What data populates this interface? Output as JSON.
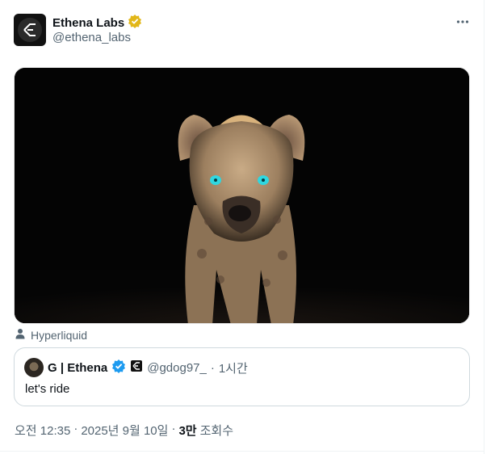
{
  "author": {
    "display_name": "Ethena Labs",
    "handle": "@ethena_labs",
    "avatar_icon": "ethena-logo-icon",
    "verified_badge": "gold-verified-badge-icon"
  },
  "more_options_icon": "more-dots-icon",
  "media": {
    "image_icon": "hyena-photo"
  },
  "source_label": {
    "icon": "person-icon",
    "text": "Hyperliquid"
  },
  "quoted_post": {
    "display_name": "G | Ethena",
    "verified_badge": "blue-verified-badge-icon",
    "affiliate_icon": "ethena-affiliate-icon",
    "handle": "@gdog97_",
    "separator": "·",
    "time": "1시간",
    "text": "let's ride"
  },
  "meta": {
    "time": "오전 12:35",
    "sep1": "·",
    "date": "2025년 9월 10일",
    "sep2": "·",
    "views_count": "3만",
    "views_label": "조회수"
  },
  "colors": {
    "text_primary": "#0f1419",
    "text_secondary": "#536471",
    "border": "#cfd9de",
    "gold_badge": "#e2b719",
    "blue_badge": "#1d9bf0"
  }
}
